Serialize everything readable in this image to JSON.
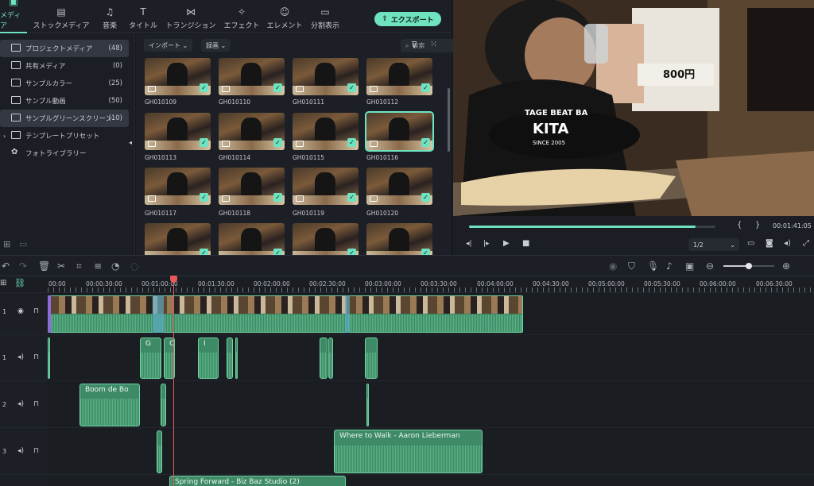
{
  "tabs": [
    {
      "label": "メディア",
      "icon": "media-icon"
    },
    {
      "label": "ストックメディア",
      "icon": "stock-media-icon"
    },
    {
      "label": "音楽",
      "icon": "music-icon"
    },
    {
      "label": "タイトル",
      "icon": "title-icon"
    },
    {
      "label": "トランジション",
      "icon": "transition-icon"
    },
    {
      "label": "エフェクト",
      "icon": "effect-icon"
    },
    {
      "label": "エレメント",
      "icon": "element-icon"
    },
    {
      "label": "分割表示",
      "icon": "split-screen-icon"
    }
  ],
  "export_label": "エクスポート",
  "sidebar": {
    "items": [
      {
        "label": "プロジェクトメディア",
        "count": "(48)"
      },
      {
        "label": "共有メディア",
        "count": "(0)"
      },
      {
        "label": "サンプルカラー",
        "count": "(25)"
      },
      {
        "label": "サンプル動画",
        "count": "(50)"
      },
      {
        "label": "サンプルグリーンスクリーン",
        "count": "(10)"
      },
      {
        "label": "テンプレートプリセット",
        "count": ""
      },
      {
        "label": "フォトライブラリー",
        "count": ""
      }
    ]
  },
  "media": {
    "import_label": "インポート",
    "record_label": "録画",
    "search_placeholder": "検索",
    "clips": [
      "GH010109",
      "GH010110",
      "GH010111",
      "GH010112",
      "GH010113",
      "GH010114",
      "GH010115",
      "GH010116",
      "GH010117",
      "GH010118",
      "GH010119",
      "GH010120",
      "",
      "",
      "",
      ""
    ]
  },
  "preview": {
    "price_sign": "800円",
    "shirt_text_1": "TAGE BEAT BA",
    "shirt_text_2": "KITA",
    "shirt_text_3": "SINCE 2005",
    "timecode": "00:01:41:05",
    "ratio": "1/2",
    "progress": 0.92,
    "brace_open": "{",
    "brace_close": "}"
  },
  "ruler": [
    "00:00",
    "00:00:30:00",
    "00:01:00:00",
    "00:01:30:00",
    "00:02:00:00",
    "00:02:30:00",
    "00:03:00:00",
    "00:03:30:00",
    "00:04:00:00",
    "00:04:30:00",
    "00:05:00:00",
    "00:05:30:00",
    "00:06:00:00",
    "00:06:30:00"
  ],
  "tracks": {
    "video1": "1",
    "audio1": "1",
    "audio2": "2",
    "audio3": "3"
  },
  "audio_clips": {
    "boom": "Boom de Bo",
    "where": "Where to Walk - Aaron Lieberman",
    "spring": "Spring Forward - Biz Baz Studio (2)",
    "small_a": "G",
    "small_b": "C",
    "small_c": "I"
  },
  "colors": {
    "accent": "#6fe3c0",
    "playhead": "#e85a5a",
    "clip": "#3f8a66"
  }
}
